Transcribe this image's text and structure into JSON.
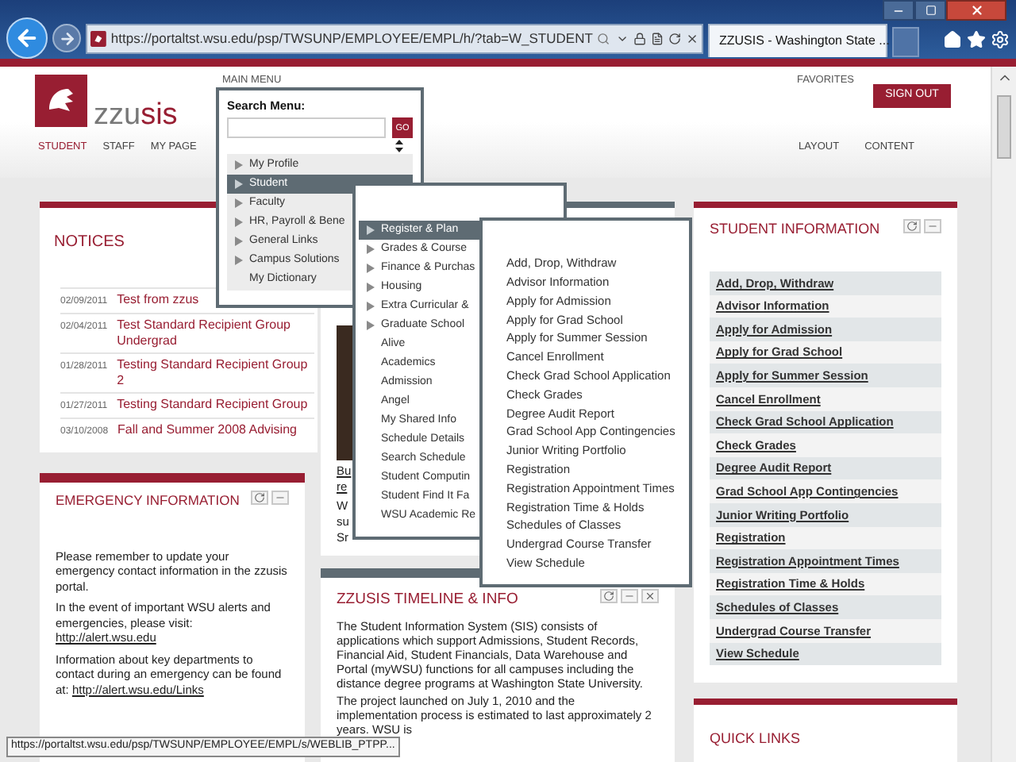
{
  "browser": {
    "address": "https://portaltst.wsu.edu/psp/TWSUNP/EMPLOYEE/EMPL/h/?tab=W_STUDENT",
    "tab_title": "ZZUSIS - Washington State ..."
  },
  "header": {
    "logo": {
      "part_1": "zzu",
      "part_2": "sis"
    },
    "main_menu": "MAIN MENU",
    "favorites": "FAVORITES",
    "sign_out": "SIGN OUT"
  },
  "nav": [
    {
      "label": "STUDENT",
      "selected": true
    },
    {
      "label": "STAFF",
      "selected": false
    },
    {
      "label": "MY PAGE",
      "selected": false
    }
  ],
  "page_links": [
    "LAYOUT",
    "CONTENT"
  ],
  "menu": {
    "search_label": "Search Menu:",
    "go": "GO",
    "items": [
      {
        "label": "My Profile",
        "expandable": true,
        "selected": false
      },
      {
        "label": "Student",
        "expandable": true,
        "selected": true
      },
      {
        "label": "Faculty",
        "expandable": true,
        "selected": false
      },
      {
        "label": "HR, Payroll & Bene",
        "expandable": true,
        "selected": false
      },
      {
        "label": "General Links",
        "expandable": true,
        "selected": false
      },
      {
        "label": "Campus Solutions",
        "expandable": true,
        "selected": false
      },
      {
        "label": "My Dictionary",
        "expandable": false,
        "selected": false
      }
    ]
  },
  "submenu": {
    "items": [
      {
        "label": "Register & Plan",
        "expandable": true,
        "selected": true
      },
      {
        "label": "Grades & Course",
        "expandable": true,
        "selected": false
      },
      {
        "label": "Finance & Purchas",
        "expandable": true,
        "selected": false
      },
      {
        "label": "Housing",
        "expandable": true,
        "selected": false
      },
      {
        "label": "Extra Curricular &",
        "expandable": true,
        "selected": false
      },
      {
        "label": "Graduate School",
        "expandable": true,
        "selected": false
      },
      {
        "label": "Alive",
        "expandable": false,
        "selected": false
      },
      {
        "label": "Academics",
        "expandable": false,
        "selected": false
      },
      {
        "label": "Admission",
        "expandable": false,
        "selected": false
      },
      {
        "label": "Angel",
        "expandable": false,
        "selected": false
      },
      {
        "label": "My Shared Info",
        "expandable": false,
        "selected": false
      },
      {
        "label": "Schedule Details",
        "expandable": false,
        "selected": false
      },
      {
        "label": "Search Schedule",
        "expandable": false,
        "selected": false
      },
      {
        "label": "Student Computin",
        "expandable": false,
        "selected": false
      },
      {
        "label": "Student Find It Fa",
        "expandable": false,
        "selected": false
      },
      {
        "label": "WSU Academic Re",
        "expandable": false,
        "selected": false
      }
    ]
  },
  "register_menu": {
    "items": [
      "Add, Drop, Withdraw",
      "Advisor Information",
      "Apply for Admission",
      "Apply for Grad School",
      "Apply for Summer Session",
      "Cancel Enrollment",
      "Check Grad School Application",
      "Check Grades",
      "Degree Audit Report",
      "Grad School App Contingencies",
      "Junior Writing Portfolio",
      "Registration",
      "Registration Appointment Times",
      "Registration Time & Holds",
      "Schedules of Classes",
      "Undergrad Course Transfer",
      "View Schedule"
    ]
  },
  "notices": {
    "title": "NOTICES",
    "items": [
      {
        "date": "02/09/2011",
        "title": "Test from zzus"
      },
      {
        "date": "02/04/2011",
        "title": "Test Standard Recipient Group Undergrad"
      },
      {
        "date": "01/28/2011",
        "title": "Testing Standard Recipient Group 2"
      },
      {
        "date": "01/27/2011",
        "title": "Testing Standard Recipient Group"
      },
      {
        "date": "03/10/2008",
        "title": "Fall and Summer 2008 Advising"
      }
    ]
  },
  "emergency": {
    "title": "EMERGENCY INFORMATION",
    "paragraphs": [
      {
        "text": "Please remember to update your emergency contact information in the zzusis portal."
      },
      {
        "text": "In the event of important WSU alerts and emergencies, please visit:",
        "link": "http://alert.wsu.edu"
      },
      {
        "text": "Information about key departments to contact during an emergency can be found at:",
        "link": "http://alert.wsu.edu/Links"
      }
    ]
  },
  "featured": {
    "link_fragments": [
      "Bu",
      "re"
    ],
    "text_fragments": [
      "W",
      "su",
      "Sr"
    ]
  },
  "timeline": {
    "title": "ZZUSIS TIMELINE & INFO",
    "paragraphs": [
      "The Student Information System (SIS) consists of applications which support Admissions, Student Records, Financial Aid, Student Financials, Data Warehouse and Portal (myWSU) functions for all campuses including the distance degree programs at Washington State University.",
      "The project launched on July 1, 2010 and the implementation process is estimated to last approximately 2 years. WSU is"
    ]
  },
  "student_information": {
    "title": "STUDENT INFORMATION",
    "links": [
      "Add, Drop, Withdraw",
      "Advisor Information",
      "Apply for Admission",
      "Apply for Grad School",
      "Apply for Summer Session",
      "Cancel Enrollment",
      "Check Grad School Application",
      "Check Grades",
      "Degree Audit Report",
      "Grad School App Contingencies",
      "Junior Writing Portfolio",
      "Registration",
      "Registration Appointment Times",
      "Registration Time & Holds",
      "Schedules of Classes",
      "Undergrad Course Transfer",
      "View Schedule"
    ]
  },
  "quick_links": {
    "title": "QUICK LINKS"
  },
  "status_url": "https://portaltst.wsu.edu/psp/TWSUNP/EMPLOYEE/EMPL/s/WEBLIB_PTPP..."
}
